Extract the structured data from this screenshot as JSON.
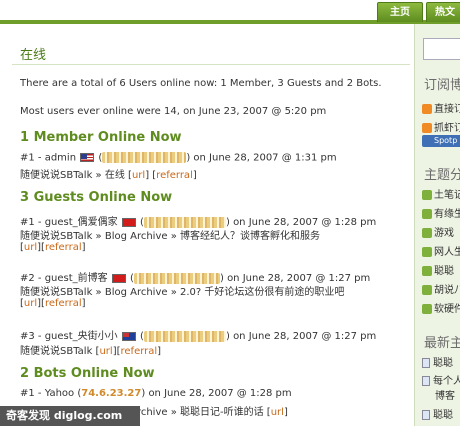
{
  "nav": {
    "home": "主页",
    "hot": "热文"
  },
  "page": {
    "title": "在线",
    "summary": "There are a total of 6 Users online now: 1 Member, 3 Guests and 2 Bots.",
    "record": "Most users ever online were 14, on June 23, 2007 @ 5:20 pm"
  },
  "members": {
    "heading": "1 Member Online Now",
    "items": [
      {
        "prefix": "#1 - admin",
        "time": "on June 28, 2007 @ 1:31 pm",
        "loc_pre": "随便说说SBTalk",
        "sep": "»",
        "loc_post": "在线",
        "url": "url",
        "ref": "referral"
      }
    ]
  },
  "guests": {
    "heading": "3 Guests Online Now",
    "items": [
      {
        "prefix": "#1 - guest_偶爱偶家",
        "time": "on June 28, 2007 @ 1:28 pm",
        "loc": "随便说说SBTalk » Blog Archive » 博客经纪人？谈博客孵化和服务",
        "url": "url",
        "ref": "referral"
      },
      {
        "prefix": "#2 - guest_前博客",
        "time": "on June 28, 2007 @ 1:27 pm",
        "loc": "随便说说SBTalk » Blog Archive » 2.0? 千好论坛这份很有前途的职业吧",
        "url": "url",
        "ref": "referral"
      },
      {
        "prefix": "#3 - guest_央街小小",
        "time": "on June 28, 2007 @ 1:27 pm",
        "loc": "随便说说SBTalk",
        "url": "url",
        "ref": "referral"
      }
    ]
  },
  "bots": {
    "heading": "2 Bots Online Now",
    "items": [
      {
        "prefix": "#1 - Yahoo",
        "ip": "74.6.23.27",
        "time": "on June 28, 2007 @ 1:28 pm",
        "loc": "随便说说SBTalk » Blog Archive » 聪聪日记-听谁的话",
        "url": "url"
      }
    ]
  },
  "sidebar": {
    "subscribe_title": "订阅博",
    "sub_items": [
      "直接订",
      "抓虾订"
    ],
    "spot": "Spotp",
    "cat_title": "主题分",
    "cats": [
      "土笔记",
      "有缘生",
      "游戏",
      "网人生",
      "聪聪",
      "胡说八",
      "软硬件"
    ],
    "recent_title": "最新主",
    "recent": [
      "聪聪",
      "每个人",
      "博客",
      "聪聪"
    ]
  },
  "watermark": "奇客发现 diglog.com"
}
